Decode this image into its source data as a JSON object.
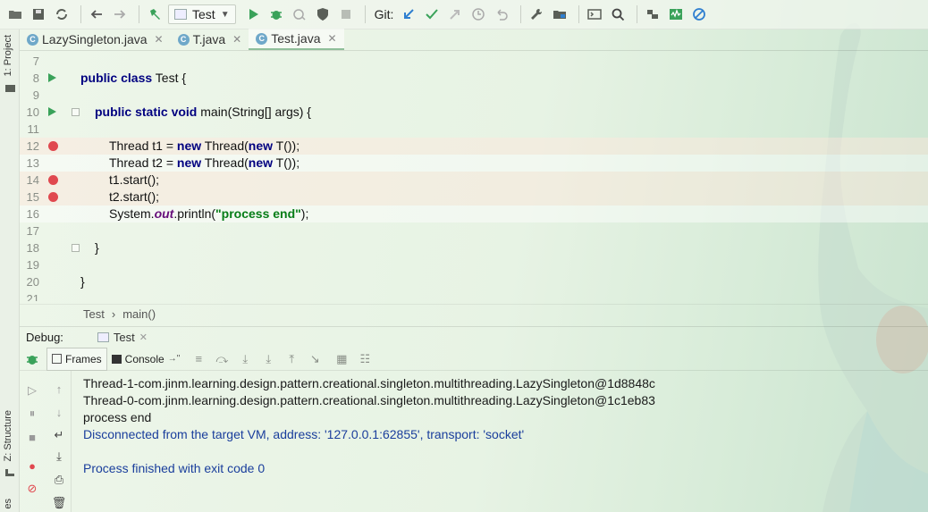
{
  "toolbar": {
    "run_config": "Test",
    "git_label": "Git:"
  },
  "left_strip": {
    "project_label": "1: Project",
    "structure_label": "Z: Structure",
    "bottom_label": "es"
  },
  "tabs": [
    {
      "label": "LazySingleton.java",
      "active": false
    },
    {
      "label": "T.java",
      "active": false
    },
    {
      "label": "Test.java",
      "active": true
    }
  ],
  "editor": {
    "lines": [
      {
        "num": "7",
        "text": ""
      },
      {
        "num": "8",
        "text": "public class Test {"
      },
      {
        "num": "9",
        "text": ""
      },
      {
        "num": "10",
        "text": "public static void main(String[] args) {"
      },
      {
        "num": "11",
        "text": ""
      },
      {
        "num": "12",
        "text": "Thread t1 = new Thread(new T());"
      },
      {
        "num": "13",
        "text": "Thread t2 = new Thread(new T());"
      },
      {
        "num": "14",
        "text": "t1.start();"
      },
      {
        "num": "15",
        "text": "t2.start();"
      },
      {
        "num": "16",
        "text": "System.out.println(\"process end\");"
      },
      {
        "num": "17",
        "text": ""
      },
      {
        "num": "18",
        "text": "}"
      },
      {
        "num": "19",
        "text": ""
      },
      {
        "num": "20",
        "text": "}"
      },
      {
        "num": "21",
        "text": ""
      }
    ]
  },
  "breadcrumb": {
    "class": "Test",
    "separator": "›",
    "method": "main()"
  },
  "debug": {
    "label": "Debug:",
    "session_tab": "Test",
    "frames_tab": "Frames",
    "console_tab": "Console"
  },
  "console": {
    "lines": [
      "Thread-1-com.jinm.learning.design.pattern.creational.singleton.multithreading.LazySingleton@1d8848c",
      "Thread-0-com.jinm.learning.design.pattern.creational.singleton.multithreading.LazySingleton@1c1eb83",
      "process end",
      "Disconnected from the target VM, address: '127.0.0.1:62855', transport: 'socket'",
      "",
      "Process finished with exit code 0"
    ]
  },
  "colors": {
    "keyword": "#000080",
    "string": "#067d17",
    "breakpoint": "#e0484f",
    "run_green": "#3aa25a",
    "system_output": "#1a3e9c"
  }
}
